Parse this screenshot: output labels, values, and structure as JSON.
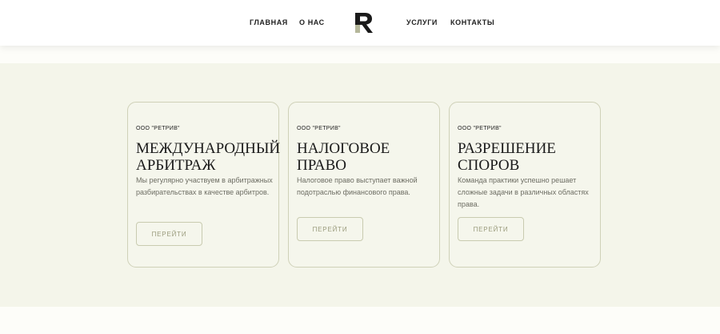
{
  "header": {
    "nav_left": [
      "ГЛАВНАЯ",
      "О НАС"
    ],
    "nav_right": [
      "УСЛУГИ",
      "КОНТАКТЫ"
    ],
    "logo_letter": "R"
  },
  "cards": [
    {
      "company": "ООО \"РЕТРИВ\"",
      "title_line1": "МЕЖДУНАРОДНЫЙ",
      "title_line2": "АРБИТРАЖ",
      "description": "Мы регулярно участвуем в арбитражных разбирательствах в качестве арбитров.",
      "button": "ПЕРЕЙТИ"
    },
    {
      "company": "ООО \"РЕТРИВ\"",
      "title_line1": "НАЛОГОВОЕ",
      "title_line2": "ПРАВО",
      "description": "Налоговое право выступает важной подотраслью финансового права.",
      "button": "ПЕРЕЙТИ"
    },
    {
      "company": "ООО \"РЕТРИВ\"",
      "title_line1": "РАЗРЕШЕНИЕ",
      "title_line2": "СПОРОВ",
      "description": "Команда практики успешно решает сложные задачи в различных областях права.",
      "button": "ПЕРЕЙТИ"
    }
  ],
  "colors": {
    "section_bg": "#f4f5ea",
    "card_border": "#cfd1b8",
    "button_text": "#9a9b7c",
    "logo_dark": "#1a1a1a",
    "logo_accent": "#b5b79a"
  }
}
